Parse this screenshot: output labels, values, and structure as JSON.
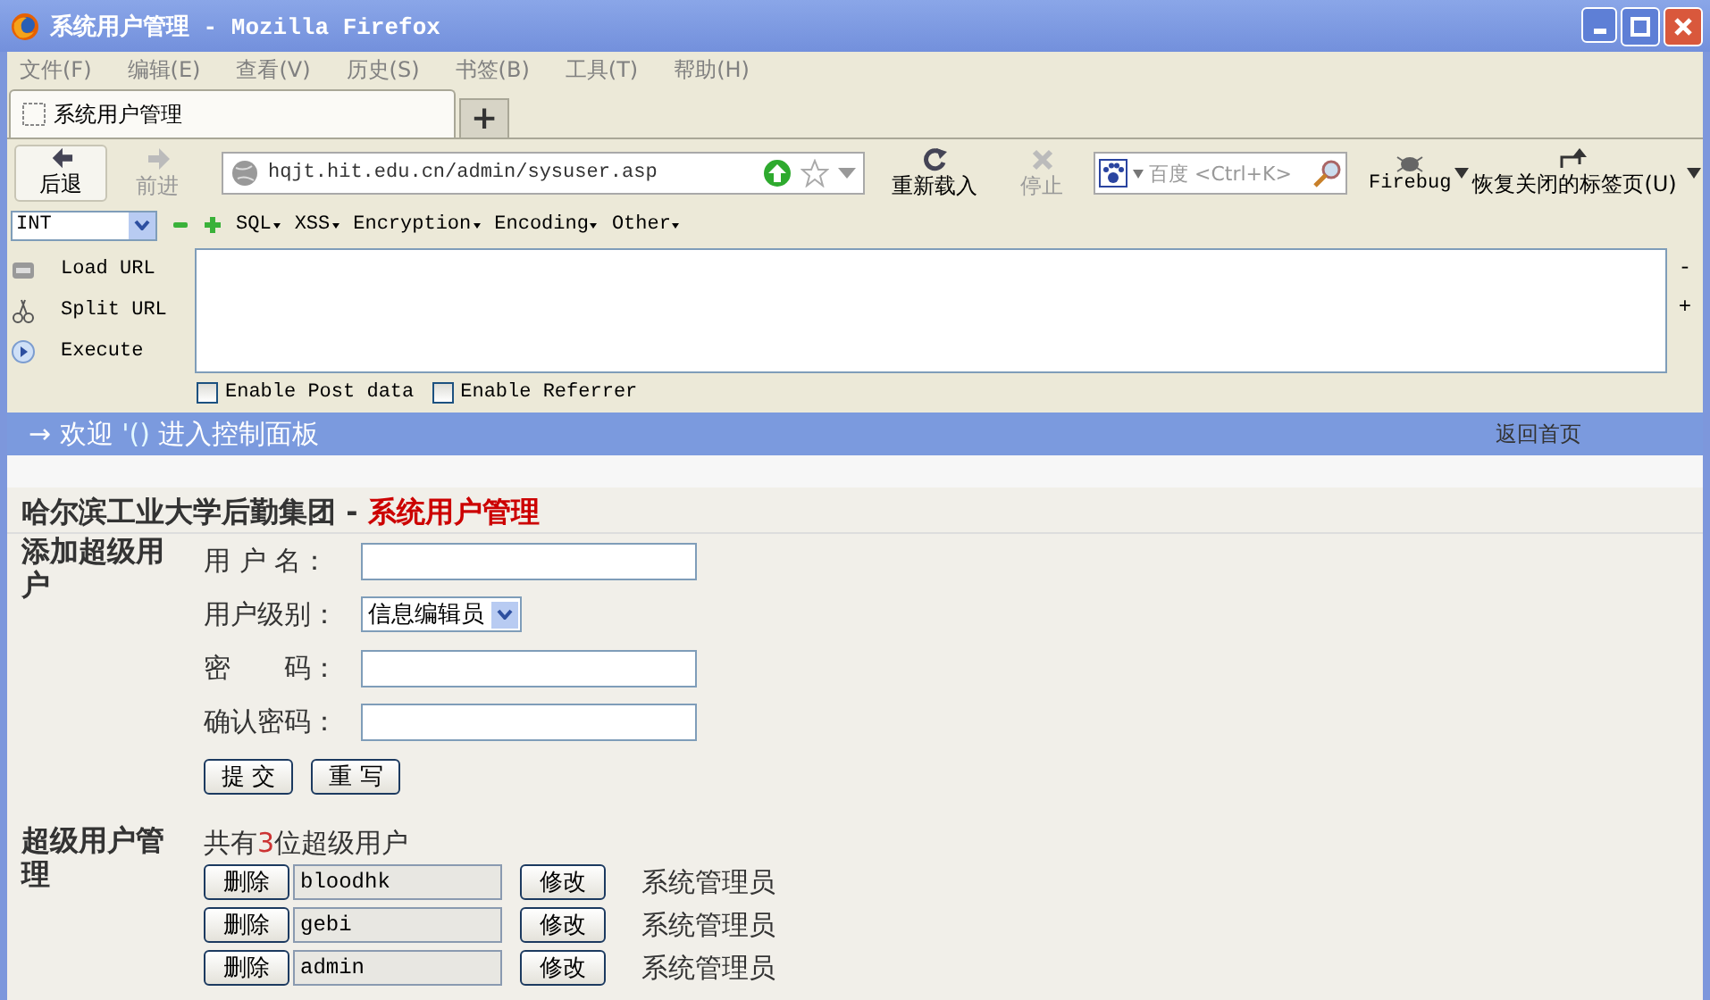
{
  "window": {
    "title": "系统用户管理 - Mozilla Firefox"
  },
  "menu": [
    "文件(F)",
    "编辑(E)",
    "查看(V)",
    "历史(S)",
    "书签(B)",
    "工具(T)",
    "帮助(H)"
  ],
  "tabs": [
    {
      "label": "系统用户管理",
      "selected": true
    }
  ],
  "new_tab": "+",
  "nav_buttons": [
    {
      "kind": "back",
      "label": "后退",
      "disabled": false
    },
    {
      "kind": "forward",
      "label": "前进",
      "disabled": true
    }
  ],
  "url": "hqjt.hit.edu.cn/admin/sysuser.asp",
  "page_buttons": [
    {
      "kind": "reload",
      "label": "重新载入",
      "disabled": false
    },
    {
      "kind": "stop",
      "label": "停止",
      "disabled": true
    }
  ],
  "search": {
    "placeholder": "百度 <Ctrl+K>"
  },
  "firebug": "Firebug",
  "restore": "恢复关闭的标签页(U)",
  "hackbar": {
    "type": "INT",
    "menus": [
      "SQL",
      "XSS",
      "Encryption",
      "Encoding",
      "Other"
    ],
    "actions": [
      {
        "kind": "load",
        "label": "Load URL"
      },
      {
        "kind": "split",
        "label": "Split URL"
      },
      {
        "kind": "execute",
        "label": "Execute"
      }
    ],
    "side": [
      "-",
      "+"
    ],
    "options": [
      {
        "label": "Enable Post data",
        "checked": false
      },
      {
        "label": "Enable Referrer",
        "checked": false
      }
    ]
  },
  "banner": {
    "arrow": "→",
    "welcome": "欢迎",
    "name": "'()",
    "rest": "进入控制面板",
    "home_link": "返回首页"
  },
  "heading": {
    "org": "哈尔滨工业大学后勤集团 - ",
    "title": "系统用户管理"
  },
  "add_user": {
    "title": "添加超级用户",
    "fields": [
      {
        "kind": "text",
        "label": "用 户 名："
      },
      {
        "kind": "select",
        "label": "用户级别：",
        "value": "信息编辑员"
      },
      {
        "kind": "text",
        "label": "密　　码："
      },
      {
        "kind": "text",
        "label": "确认密码："
      }
    ],
    "buttons": [
      "提 交",
      "重 写"
    ]
  },
  "manage": {
    "title": "超级用户管理",
    "count_prefix": "共有",
    "count": "3",
    "count_suffix": "位超级用户",
    "users": [
      {
        "delete": "删除",
        "name": "bloodhk",
        "edit": "修改",
        "role": "系统管理员"
      },
      {
        "delete": "删除",
        "name": "gebi",
        "edit": "修改",
        "role": "系统管理员"
      },
      {
        "delete": "删除",
        "name": "admin",
        "edit": "修改",
        "role": "系统管理员"
      }
    ]
  }
}
